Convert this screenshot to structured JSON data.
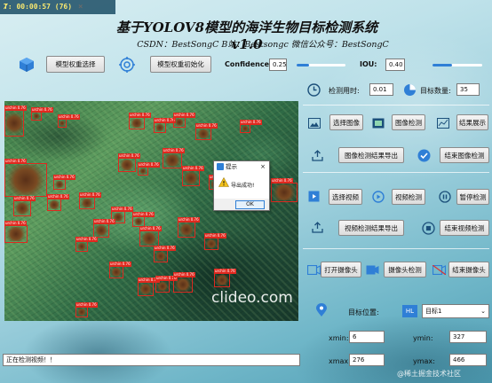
{
  "window": {
    "title": "Ⱦ: 00:00:57 (76)",
    "close_glyph": "×"
  },
  "header": {
    "title": "基于YOLOV8模型的海洋生物目标检测系统 v1.0",
    "subtitle": "CSDN：BestSongC   B站：Bestsongc   微信公众号：BestSongC"
  },
  "toolbar": {
    "model_select_label": "模型权重选择",
    "model_init_label": "模型权重初始化",
    "confidence_label": "Confidence",
    "confidence_value": "0.25",
    "confidence_level": 0.25,
    "iou_label": "IOU:",
    "iou_value": "0.40",
    "iou_level": 0.4
  },
  "stats": {
    "time_label": "检测用时:",
    "time_value": "0.01",
    "count_label": "目标数量:",
    "count_value": "35"
  },
  "image_panel": {
    "row1": {
      "select_image": "选择图像",
      "detect_image": "图像检测",
      "show_result": "结果展示"
    },
    "row2": {
      "export_image_result": "图像检测结果导出",
      "end_image_detect": "结束图像检测"
    }
  },
  "video_panel": {
    "row1": {
      "select_video": "选择视频",
      "detect_video": "视频检测",
      "pause_detect": "暂停检测"
    },
    "row2": {
      "export_video_result": "视频检测结果导出",
      "end_video_detect": "结束视频检测"
    }
  },
  "camera_panel": {
    "open_camera": "打开摄像头",
    "camera_detect": "摄像头检测",
    "end_camera": "结束摄像头"
  },
  "target_panel": {
    "position_label": "目标位置:",
    "class_badge": "HL",
    "target_select_value": "目标1",
    "xmin_label": "xmin:",
    "xmin_value": "6",
    "ymin_label": "ymin:",
    "ymin_value": "327",
    "xmax_label": "xmax:",
    "xmax_value": "276",
    "ymax_label": "ymax:",
    "ymax_value": "466"
  },
  "dialog": {
    "title": "提示",
    "message": "导出成功!",
    "ok_label": "OK"
  },
  "viewer": {
    "watermark": "clideo.com",
    "box_label": "urchin 0.76"
  },
  "status": {
    "text": "正在检测视频！！"
  },
  "footer": {
    "credit": "@稀土掘金技术社区"
  },
  "colors": {
    "accent": "#2f7fd6",
    "box": "#e0281e"
  }
}
